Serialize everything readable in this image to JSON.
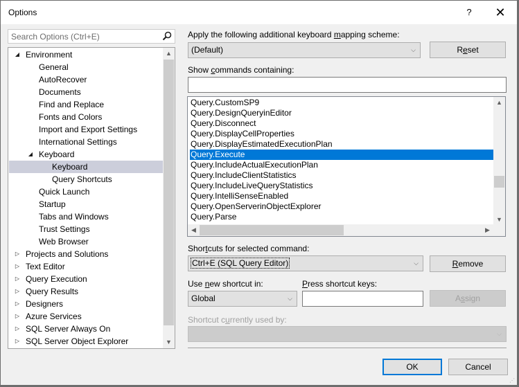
{
  "window": {
    "title": "Options",
    "help_label": "?",
    "close_label": "✕"
  },
  "search": {
    "placeholder": "Search Options (Ctrl+E)",
    "value": "",
    "icon": "search-icon"
  },
  "tree": {
    "items": [
      {
        "label": "Environment",
        "level": 0,
        "expander": "expanded"
      },
      {
        "label": "General",
        "level": 1,
        "expander": "none"
      },
      {
        "label": "AutoRecover",
        "level": 1,
        "expander": "none"
      },
      {
        "label": "Documents",
        "level": 1,
        "expander": "none"
      },
      {
        "label": "Find and Replace",
        "level": 1,
        "expander": "none"
      },
      {
        "label": "Fonts and Colors",
        "level": 1,
        "expander": "none"
      },
      {
        "label": "Import and Export Settings",
        "level": 1,
        "expander": "none"
      },
      {
        "label": "International Settings",
        "level": 1,
        "expander": "none"
      },
      {
        "label": "Keyboard",
        "level": 1,
        "expander": "expanded"
      },
      {
        "label": "Keyboard",
        "level": 2,
        "expander": "none",
        "selected": true
      },
      {
        "label": "Query Shortcuts",
        "level": 2,
        "expander": "none"
      },
      {
        "label": "Quick Launch",
        "level": 1,
        "expander": "none"
      },
      {
        "label": "Startup",
        "level": 1,
        "expander": "none"
      },
      {
        "label": "Tabs and Windows",
        "level": 1,
        "expander": "none"
      },
      {
        "label": "Trust Settings",
        "level": 1,
        "expander": "none"
      },
      {
        "label": "Web Browser",
        "level": 1,
        "expander": "none"
      },
      {
        "label": "Projects and Solutions",
        "level": 0,
        "expander": "collapsed"
      },
      {
        "label": "Text Editor",
        "level": 0,
        "expander": "collapsed"
      },
      {
        "label": "Query Execution",
        "level": 0,
        "expander": "collapsed"
      },
      {
        "label": "Query Results",
        "level": 0,
        "expander": "collapsed"
      },
      {
        "label": "Designers",
        "level": 0,
        "expander": "collapsed"
      },
      {
        "label": "Azure Services",
        "level": 0,
        "expander": "collapsed"
      },
      {
        "label": "SQL Server Always On",
        "level": 0,
        "expander": "collapsed"
      },
      {
        "label": "SQL Server Object Explorer",
        "level": 0,
        "expander": "collapsed"
      }
    ]
  },
  "mapping": {
    "label_pre": "Apply the following additional keyboard ",
    "label_key": "m",
    "label_post": "apping scheme:",
    "selected": "(Default)",
    "reset_pre": "R",
    "reset_key": "e",
    "reset_post": "set"
  },
  "commands": {
    "label_pre": "Show ",
    "label_key": "c",
    "label_post": "ommands containing:",
    "filter_value": "",
    "items": [
      "Query.CustomSP9",
      "Query.DesignQueryinEditor",
      "Query.Disconnect",
      "Query.DisplayCellProperties",
      "Query.DisplayEstimatedExecutionPlan",
      "Query.Execute",
      "Query.IncludeActualExecutionPlan",
      "Query.IncludeClientStatistics",
      "Query.IncludeLiveQueryStatistics",
      "Query.IntelliSenseEnabled",
      "Query.OpenServerinObjectExplorer",
      "Query.Parse"
    ],
    "selected_index": 5
  },
  "shortcuts": {
    "label_pre": "Shor",
    "label_key": "t",
    "label_post": "cuts for selected command:",
    "selected": "Ctrl+E (SQL Query Editor)",
    "remove_key": "R",
    "remove_post": "emove"
  },
  "new_shortcut": {
    "use_in_pre": "Use ",
    "use_in_key": "n",
    "use_in_post": "ew shortcut in:",
    "use_in_value": "Global",
    "press_key": "P",
    "press_post": "ress shortcut keys:",
    "press_value": "",
    "assign_pre": "A",
    "assign_key": "s",
    "assign_post": "sign"
  },
  "used_by": {
    "label_pre": "Shortcut c",
    "label_key": "u",
    "label_post": "rrently used by:",
    "value": ""
  },
  "footer": {
    "ok_label": "OK",
    "cancel_label": "Cancel"
  },
  "colors": {
    "selection": "#0078d7",
    "tree_selection": "#cccedb",
    "dialog_bg": "#f0f0f0"
  }
}
